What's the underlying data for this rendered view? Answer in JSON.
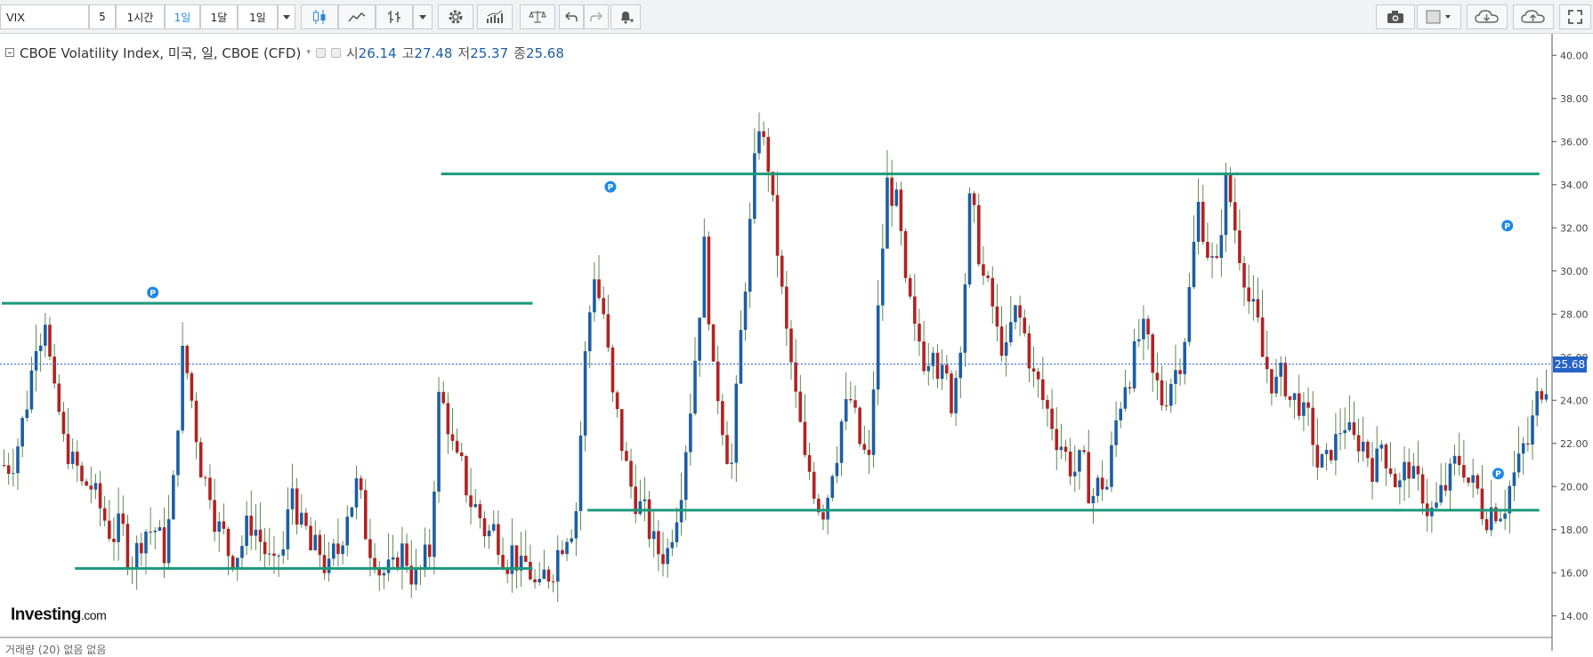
{
  "toolbar": {
    "symbol": "VIX",
    "intervals": [
      "5",
      "1시간",
      "1일",
      "1달",
      "1일"
    ],
    "active_interval_index": 2
  },
  "legend": {
    "name": "CBOE Volatility Index, 미국, 일, CBOE (CFD)",
    "open_label": "시",
    "open": "26.14",
    "high_label": "고",
    "high": "27.48",
    "low_label": "저",
    "low": "25.37",
    "close_label": "종",
    "close": "25.68"
  },
  "current_price": "25.68",
  "volume_legend": "거래량 (20)       없음  없음",
  "brand": {
    "name": "Investing",
    "domain": ".com"
  },
  "colors": {
    "up": "#1b5fa3",
    "down": "#b22222",
    "level_line": "#1a9a7a",
    "price_tag": "#2563c7"
  },
  "chart_data": {
    "type": "candlestick",
    "ylim": [
      13,
      41
    ],
    "y_ticks": [
      "40.00",
      "38.00",
      "36.00",
      "34.00",
      "32.00",
      "30.00",
      "28.00",
      "26.00",
      "24.00",
      "22.00",
      "20.00",
      "18.00",
      "16.00",
      "14.00"
    ],
    "series_close": [
      21,
      22,
      24,
      27,
      28,
      24,
      22,
      21,
      20,
      20,
      19,
      18,
      18,
      17,
      17,
      18,
      18,
      17,
      20,
      26,
      24,
      21,
      20,
      18,
      17,
      17,
      18,
      18,
      17,
      16,
      17,
      20,
      18,
      17,
      17,
      16,
      17,
      19,
      20,
      18,
      17,
      16,
      16,
      17,
      16,
      16,
      17,
      24,
      23,
      21,
      20,
      19,
      18,
      18,
      17,
      17,
      16,
      16,
      15,
      16,
      17,
      18,
      19,
      26,
      30,
      28,
      24,
      22,
      20,
      19,
      18,
      17,
      17,
      19,
      22,
      26,
      31,
      25,
      23,
      21,
      27,
      32,
      37,
      35,
      31,
      27,
      24,
      21,
      20,
      19,
      21,
      23,
      24,
      22,
      21,
      28,
      34,
      33,
      29,
      27,
      26,
      27,
      25,
      24,
      27,
      33,
      31,
      29,
      27,
      26,
      28,
      27,
      25,
      24,
      23,
      22,
      21,
      21,
      20,
      20,
      20,
      23,
      25,
      26,
      27,
      25,
      24,
      25,
      26,
      29,
      33,
      31,
      30,
      34,
      32,
      30,
      28,
      26,
      25,
      25,
      24,
      24,
      23,
      21,
      21,
      22,
      23,
      22,
      22,
      21,
      22,
      21,
      20,
      21,
      20,
      19,
      19,
      20,
      21,
      21,
      20,
      19,
      19,
      19,
      20,
      21,
      22,
      24,
      25
    ],
    "levels": [
      {
        "value": 28.5,
        "from_index": 0,
        "to_index": 58
      },
      {
        "value": 16.2,
        "from_index": 8,
        "to_index": 58
      },
      {
        "value": 34.5,
        "from_index": 48,
        "to_index": 168
      },
      {
        "value": 18.9,
        "from_index": 64,
        "to_index": 168
      }
    ],
    "markers": [
      {
        "label": "P",
        "index": 16,
        "value": 29.0
      },
      {
        "label": "P",
        "index": 66,
        "value": 33.9
      },
      {
        "label": "P",
        "index": 164,
        "value": 32.1
      },
      {
        "label": "P",
        "index": 163,
        "value": 20.6
      }
    ],
    "current_price_line": 25.68
  }
}
